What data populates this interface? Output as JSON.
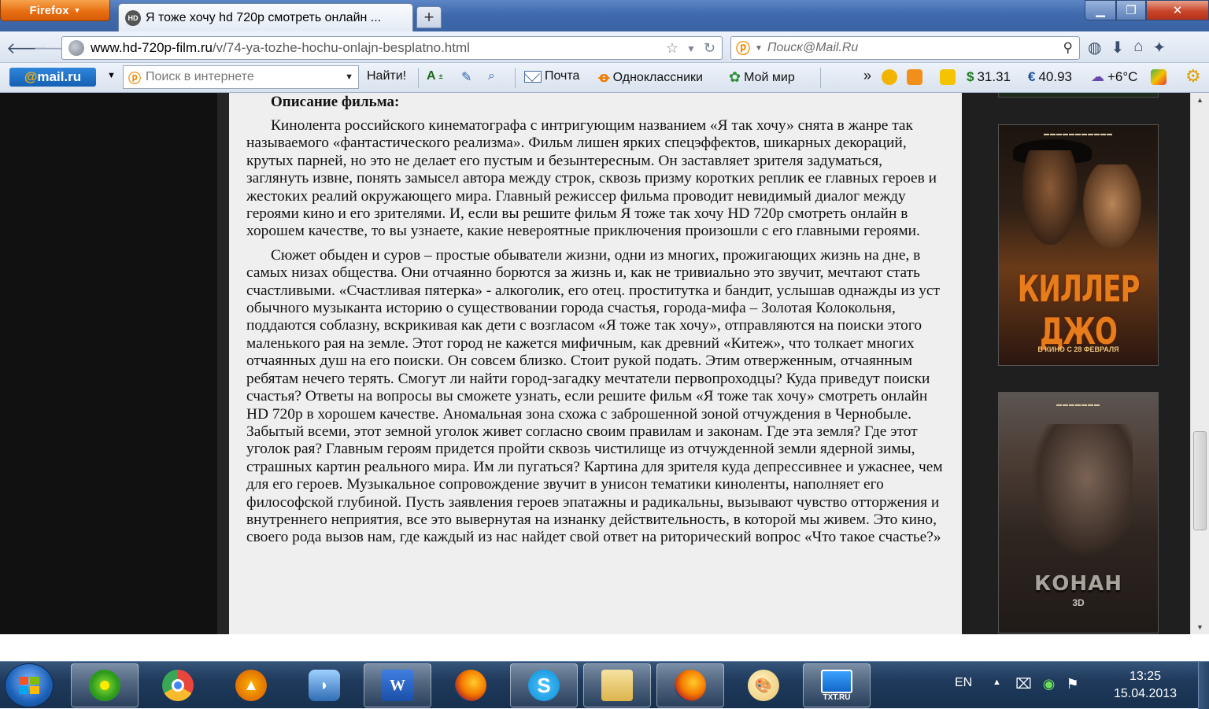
{
  "browser": {
    "menu_button": "Firefox",
    "tab": {
      "favicon": "HD",
      "title": "Я тоже хочу hd 720p смотреть онлайн ..."
    },
    "new_tab": "+",
    "url": {
      "host": "www.hd-720p-film.ru",
      "path": "/v/74-ya-tozhe-hochu-onlajn-besplatno.html"
    },
    "search_placeholder": "Поиск@Mail.Ru",
    "window_controls": {
      "minimize": "▁",
      "maximize": "❐",
      "close": "✕"
    }
  },
  "mail_toolbar": {
    "logo_at": "@",
    "logo_text": "mail.ru",
    "search_placeholder": "Поиск в интернете",
    "find_button": "Найти!",
    "links": [
      "Почта",
      "Одноклассники",
      "Мой мир"
    ],
    "more": "»",
    "usd": "31.31",
    "usd_sign": "$",
    "eur": "40.93",
    "eur_sign": "€",
    "weather": "+6°C"
  },
  "article": {
    "heading": "Описание фильма:",
    "paragraphs": [
      "Кинолента российского кинематографа с интригующим названием «Я так хочу» снята в жанре так называемого «фантастического реализма». Фильм лишен ярких спецэффектов, шикарных декораций, крутых парней, но это не делает его пустым и безынтересным. Он заставляет зрителя задуматься, заглянуть извне, понять замысел автора между строк, сквозь призму коротких реплик ее главных героев и жестоких реалий окружающего мира. Главный режиссер фильма проводит невидимый диалог между героями кино и его зрителями. И, если вы решите фильм Я тоже так хочу HD 720p смотреть онлайн в хорошем качестве, то вы узнаете, какие невероятные приключения произошли с его главными героями.",
      "Сюжет обыден и суров – простые обыватели жизни, одни из многих, прожигающих жизнь на дне, в самых низах общества. Они отчаянно борются за жизнь и, как не тривиально это звучит, мечтают стать счастливыми. «Счастливая пятерка» - алкоголик, его отец. проститутка и бандит, услышав однажды из уст обычного музыканта историю о существовании города счастья, города-мифа – Золотая Колокольня, поддаются соблазну, вскрикивая как дети с возгласом «Я тоже так хочу», отправляются на поиски этого маленького рая на земле. Этот город не кажется мифичным, как древний «Китеж», что толкает многих отчаянных душ на его поиски. Он совсем близко. Стоит рукой подать. Этим отверженным, отчаянным ребятам нечего терять. Смогут ли найти город-загадку мечтатели первопроходцы? Куда приведут поиски счастья? Ответы на вопросы вы сможете узнать, если решите фильм «Я тоже так хочу» смотреть онлайн HD 720p в хорошем качестве. Аномальная зона схожа с заброшенной зоной отчуждения в Чернобыле. Забытый всеми, этот земной уголок живет согласно своим правилам и законам. Где эта земля? Где этот уголок рая? Главным героям придется пройти сквозь чистилище из отчужденной земли ядерной зимы, страшных картин реального мира. Им ли пугаться? Картина для зрителя куда депрессивнее и ужаснее, чем для его героев. Музыкальное сопровождение звучит в унисон тематики киноленты, наполняет его философской глубиной. Пусть заявления героев эпатажны и радикальны, вызывают чувство отторжения и внутреннего неприятия, все это вывернутая на изнанку действительность, в которой мы живем. Это кино, своего рода вызов нам, где каждый из нас найдет свой ответ на риторический вопрос «Что такое счастье?»"
    ]
  },
  "sidebar": {
    "posters": [
      {
        "title": "КИЛЛЕР ДЖО",
        "date": "В КИНО С 28 ФЕВРАЛЯ",
        "accent": "#e77c1a"
      },
      {
        "title": "КОНАН",
        "subtitle": "3D",
        "accent": "#a9a39b"
      }
    ]
  },
  "taskbar": {
    "apps": [
      "icq",
      "chrome",
      "aimp",
      "xtorrent",
      "word",
      "firefox",
      "skype",
      "explorer",
      "firefox",
      "paint",
      "txt-ru"
    ],
    "txt_ru_label": "TXT.RU",
    "language": "EN",
    "time": "13:25",
    "date": "15.04.2013"
  }
}
